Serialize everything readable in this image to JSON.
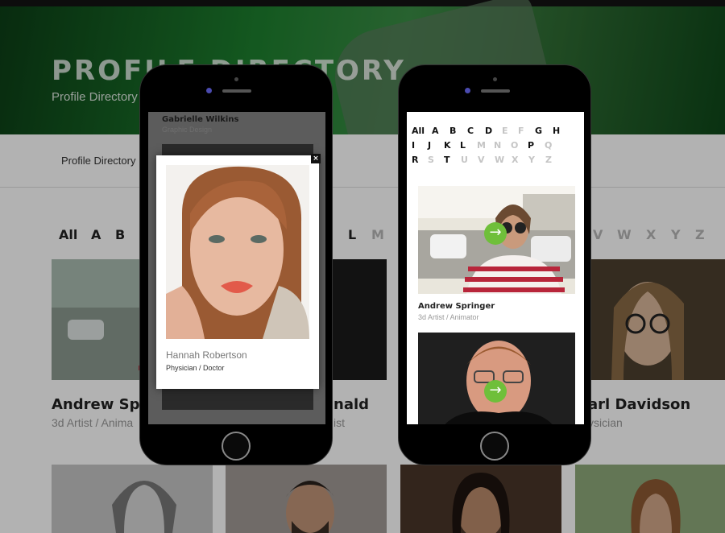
{
  "hero": {
    "title": "PROFILE DIRECTORY",
    "breadcrumb": "Profile Directory"
  },
  "subnav": {
    "link": "Profile Directory"
  },
  "background": {
    "letters_left": [
      {
        "label": "All",
        "active": true
      },
      {
        "label": "A",
        "active": true
      },
      {
        "label": "B",
        "active": true
      }
    ],
    "letters_mid": [
      {
        "label": "L",
        "active": true
      },
      {
        "label": "M",
        "active": false
      }
    ],
    "letters_right": [
      {
        "label": "V",
        "active": false
      },
      {
        "label": "W",
        "active": false
      },
      {
        "label": "X",
        "active": false
      },
      {
        "label": "Y",
        "active": false
      },
      {
        "label": "Z",
        "active": false
      }
    ],
    "cards": [
      {
        "name": "Andrew Spri",
        "role": "3d Artist / Anima"
      },
      {
        "name": "nald",
        "role": "ist"
      },
      {
        "name": "arl Davidson",
        "role": "ysician"
      }
    ]
  },
  "phone_left": {
    "top_card": {
      "name": "Gabrielle Wilkins",
      "role": "Graphic Design"
    },
    "modal": {
      "close": "×",
      "name": "Hannah Robertson",
      "role": "Physician / Doctor"
    }
  },
  "phone_right": {
    "letters": [
      {
        "label": "All",
        "active": true
      },
      {
        "label": "A",
        "active": true
      },
      {
        "label": "B",
        "active": true
      },
      {
        "label": "C",
        "active": true
      },
      {
        "label": "D",
        "active": true
      },
      {
        "label": "E",
        "active": false
      },
      {
        "label": "F",
        "active": false
      },
      {
        "label": "G",
        "active": true
      },
      {
        "label": "H",
        "active": true
      },
      {
        "label": "I",
        "active": true
      },
      {
        "label": "J",
        "active": true
      },
      {
        "label": "K",
        "active": true
      },
      {
        "label": "L",
        "active": true
      },
      {
        "label": "M",
        "active": false
      },
      {
        "label": "N",
        "active": false
      },
      {
        "label": "O",
        "active": false
      },
      {
        "label": "P",
        "active": true
      },
      {
        "label": "Q",
        "active": false
      },
      {
        "label": "R",
        "active": true
      },
      {
        "label": "S",
        "active": false
      },
      {
        "label": "T",
        "active": true
      },
      {
        "label": "U",
        "active": false
      },
      {
        "label": "V",
        "active": false
      },
      {
        "label": "W",
        "active": false
      },
      {
        "label": "X",
        "active": false
      },
      {
        "label": "Y",
        "active": false
      },
      {
        "label": "Z",
        "active": false
      }
    ],
    "cards": [
      {
        "name": "Andrew Springer",
        "role": "3d Artist / Animator"
      }
    ],
    "arrow_icon": "→"
  },
  "colors": {
    "accent": "#6fbf3a",
    "hero": "#1d7f2e"
  }
}
